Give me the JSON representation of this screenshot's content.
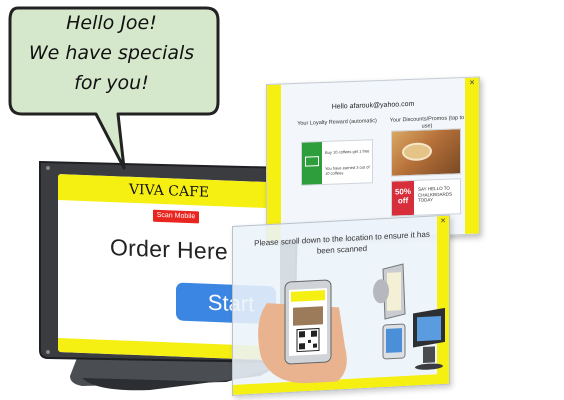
{
  "bubble": {
    "line1": "Hello Joe!",
    "line2": "We have specials",
    "line3": "for you!"
  },
  "kiosk": {
    "header": "VIVA CAFE",
    "scan_button": "Scan Mobile",
    "order_text": "Order Here",
    "start_button": "Start"
  },
  "rewards_panel": {
    "greeting": "Hello afarouk@yahoo.com",
    "loyalty_title": "Your Loyalty Reward (automatic)",
    "discounts_title": "Your Discounts/Promos (tap to use)",
    "loyalty_line1": "Buy 10 coffees get 1 free",
    "loyalty_line2": "You have earned 3 out of 10 coffees",
    "promo_badge": "50% off",
    "promo_text": "SAY HELLO TO CHALKBOARDS TODAY"
  },
  "scroll_panel": {
    "text": "Please scroll down to the location to ensure it has been scanned"
  },
  "colors": {
    "yellow": "#f6ef12",
    "start_blue": "#3b86e3",
    "scan_red": "#e8251f",
    "loyalty_green": "#2e9e3c"
  }
}
